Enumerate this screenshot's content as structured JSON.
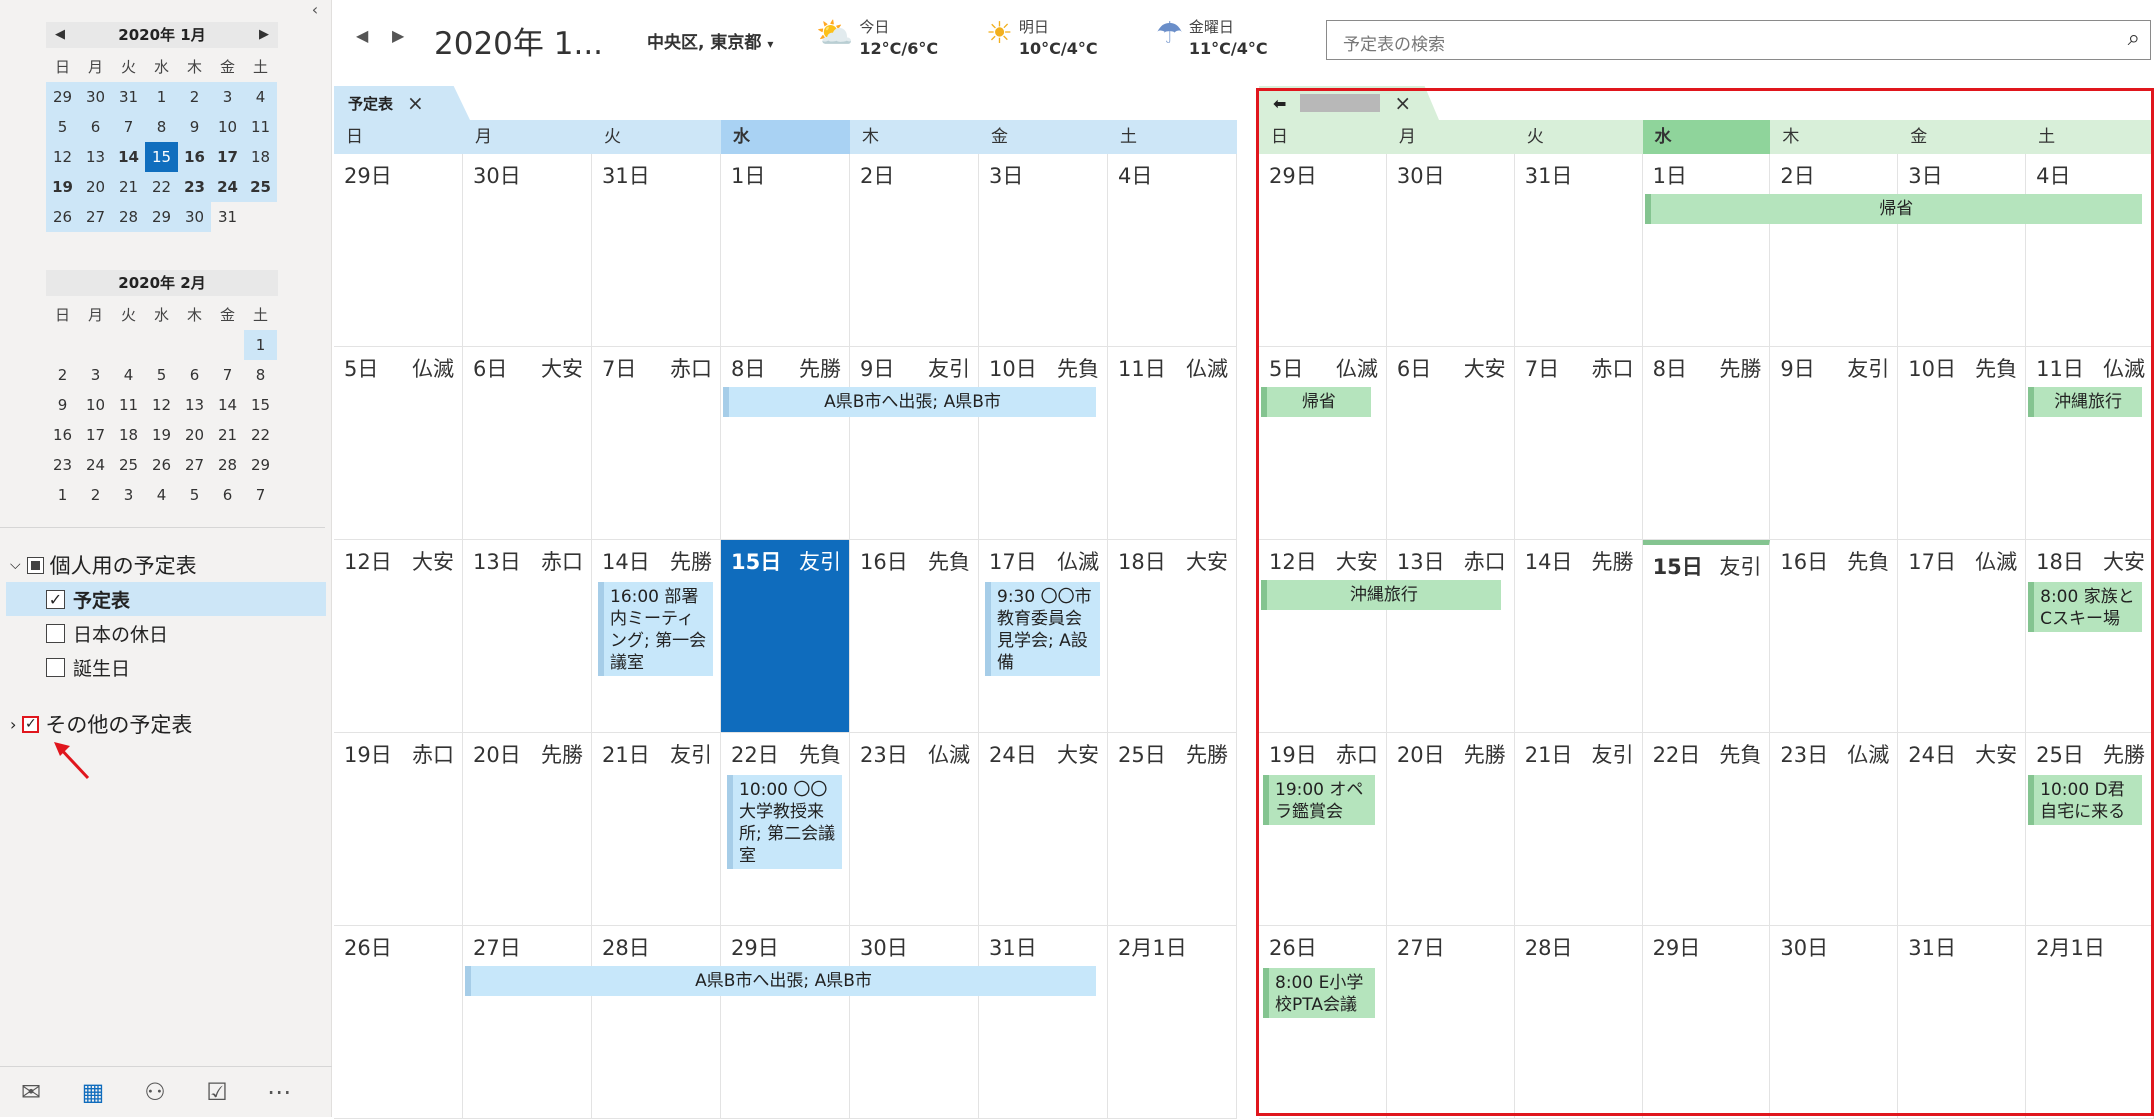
{
  "mini_cal_jan": {
    "title": "2020年 1月",
    "weekdays": [
      "日",
      "月",
      "火",
      "水",
      "木",
      "金",
      "土"
    ],
    "days": [
      "29",
      "30",
      "31",
      "1",
      "2",
      "3",
      "4",
      "5",
      "6",
      "7",
      "8",
      "9",
      "10",
      "11",
      "12",
      "13",
      "14",
      "15",
      "16",
      "17",
      "18",
      "19",
      "20",
      "21",
      "22",
      "23",
      "24",
      "25",
      "26",
      "27",
      "28",
      "29",
      "30",
      "31",
      ""
    ]
  },
  "mini_cal_feb": {
    "title": "2020年 2月",
    "weekdays": [
      "日",
      "月",
      "火",
      "水",
      "木",
      "金",
      "土"
    ],
    "days": [
      "",
      "",
      "",
      "",
      "",
      "",
      "1",
      "2",
      "3",
      "4",
      "5",
      "6",
      "7",
      "8",
      "9",
      "10",
      "11",
      "12",
      "13",
      "14",
      "15",
      "16",
      "17",
      "18",
      "19",
      "20",
      "21",
      "22",
      "23",
      "24",
      "25",
      "26",
      "27",
      "28",
      "29",
      "1",
      "2",
      "3",
      "4",
      "5",
      "6",
      "7"
    ]
  },
  "groups": {
    "personal": "個人用の予定表",
    "items": [
      {
        "label": "予定表",
        "checked": true
      },
      {
        "label": "日本の休日",
        "checked": false
      },
      {
        "label": "誕生日",
        "checked": false
      }
    ],
    "other": "その他の予定表"
  },
  "bottom_nav": [
    "mail-icon",
    "calendar-icon",
    "people-icon",
    "tasks-icon",
    "more-icon"
  ],
  "header": {
    "title": "2020年 1...",
    "location": "中央区, 東京都",
    "weather": [
      {
        "label": "今日",
        "temp": "12°C/6°C",
        "icon": "partly-sunny-icon"
      },
      {
        "label": "明日",
        "temp": "10°C/4°C",
        "icon": "sunny-icon"
      },
      {
        "label": "金曜日",
        "temp": "11°C/4°C",
        "icon": "rain-icon"
      }
    ],
    "search_placeholder": "予定表の検索"
  },
  "left_calendar": {
    "tab": "予定表",
    "weekdays": [
      "日",
      "月",
      "火",
      "水",
      "木",
      "金",
      "土"
    ]
  },
  "right_calendar": {
    "weekdays": [
      "日",
      "月",
      "火",
      "水",
      "木",
      "金",
      "土"
    ]
  },
  "weeks": [
    [
      [
        "29日",
        ""
      ],
      [
        "30日",
        ""
      ],
      [
        "31日",
        ""
      ],
      [
        "1日",
        ""
      ],
      [
        "2日",
        ""
      ],
      [
        "3日",
        ""
      ],
      [
        "4日",
        ""
      ]
    ],
    [
      [
        "5日",
        "仏滅"
      ],
      [
        "6日",
        "大安"
      ],
      [
        "7日",
        "赤口"
      ],
      [
        "8日",
        "先勝"
      ],
      [
        "9日",
        "友引"
      ],
      [
        "10日",
        "先負"
      ],
      [
        "11日",
        "仏滅"
      ]
    ],
    [
      [
        "12日",
        "大安"
      ],
      [
        "13日",
        "赤口"
      ],
      [
        "14日",
        "先勝"
      ],
      [
        "15日",
        "友引"
      ],
      [
        "16日",
        "先負"
      ],
      [
        "17日",
        "仏滅"
      ],
      [
        "18日",
        "大安"
      ]
    ],
    [
      [
        "19日",
        "赤口"
      ],
      [
        "20日",
        "先勝"
      ],
      [
        "21日",
        "友引"
      ],
      [
        "22日",
        "先負"
      ],
      [
        "23日",
        "仏滅"
      ],
      [
        "24日",
        "大安"
      ],
      [
        "25日",
        "先勝"
      ]
    ],
    [
      [
        "26日",
        ""
      ],
      [
        "27日",
        ""
      ],
      [
        "28日",
        ""
      ],
      [
        "29日",
        ""
      ],
      [
        "30日",
        ""
      ],
      [
        "31日",
        ""
      ],
      [
        "2月1日",
        ""
      ]
    ]
  ],
  "events_left": {
    "trip1": "A県B市へ出張; A県B市",
    "meeting": "16:00 部署内ミーティング; 第一会議室",
    "visit": "9:30 〇〇市教育委員会見学会; A設備",
    "univ": "10:00 〇〇大学教授来所; 第二会議室",
    "trip2": "A県B市へ出張; A県B市"
  },
  "events_right": {
    "kisei1": "帰省",
    "kisei2": "帰省",
    "okinawa1": "沖縄旅行",
    "okinawa2": "沖縄旅行",
    "ski": "8:00 家族とCスキー場",
    "opera": "19:00 オペラ鑑賞会",
    "dkun": "10:00 D君自宅に来る",
    "pta": "8:00 E小学校PTA会議"
  }
}
